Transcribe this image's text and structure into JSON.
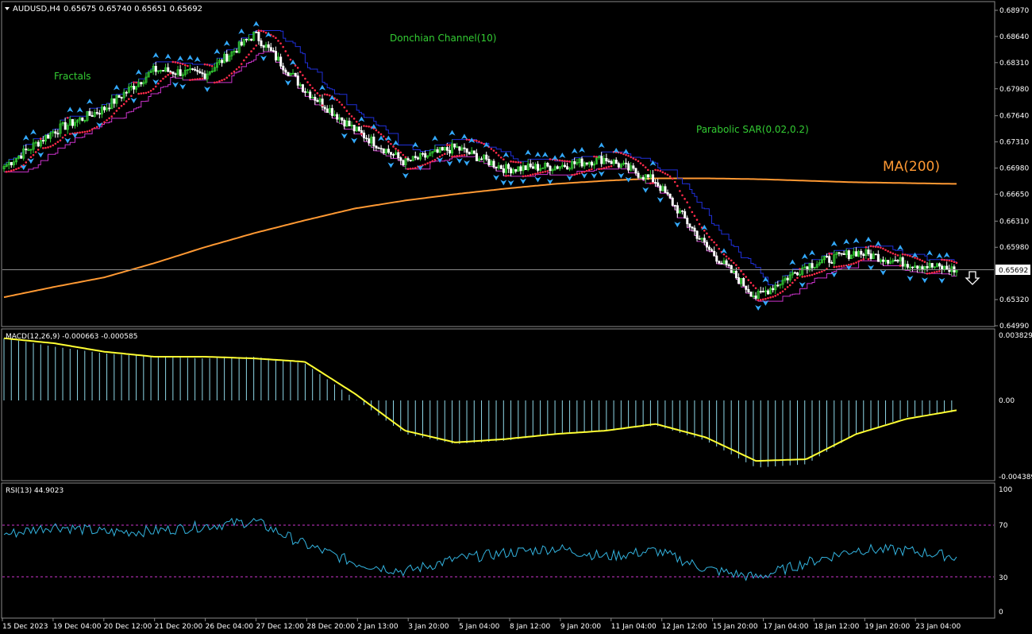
{
  "header": {
    "symbol": "AUDUSD,H4",
    "ohlc": "0.65675 0.65740 0.65651 0.65692"
  },
  "annotations": {
    "fractals": "Fractals",
    "donchian": "Donchian Channel(10)",
    "sar": "Parabolic SAR(0.02,0.2)",
    "ma": "MA(200)"
  },
  "price_axis": {
    "ticks": [
      "0.68970",
      "0.68640",
      "0.68310",
      "0.67980",
      "0.67640",
      "0.67310",
      "0.66980",
      "0.66650",
      "0.66310",
      "0.65980",
      "0.65320",
      "0.64990"
    ],
    "current_price_label": "0.65692"
  },
  "macd": {
    "label": "MACD(12,26,9) -0.000663 -0.000585",
    "ticks": [
      "0.003829",
      "0.00",
      "-0.004389"
    ]
  },
  "rsi": {
    "label": "RSI(13) 44.9023",
    "ticks": [
      "100",
      "70",
      "30",
      "0"
    ]
  },
  "time_axis": {
    "labels": [
      "15 Dec 2023",
      "19 Dec 04:00",
      "20 Dec 12:00",
      "21 Dec 20:00",
      "26 Dec 04:00",
      "27 Dec 12:00",
      "28 Dec 20:00",
      "2 Jan 13:00",
      "3 Jan 20:00",
      "5 Jan 04:00",
      "8 Jan 12:00",
      "9 Jan 20:00",
      "11 Jan 04:00",
      "12 Jan 12:00",
      "15 Jan 20:00",
      "17 Jan 04:00",
      "18 Jan 12:00",
      "19 Jan 20:00",
      "23 Jan 04:00"
    ]
  },
  "colors": {
    "background": "#000000",
    "bull_candle": "#33cc33",
    "bear_candle": "#ffffff",
    "donchian_upper": "#1f2fd8",
    "donchian_lower": "#cc33cc",
    "ma": "#ff9933",
    "sar": "#ff2a4a",
    "fractal": "#33aaff",
    "macd_hist": "#8fd8e8",
    "macd_signal": "#ffff33",
    "rsi_line": "#33b4e0",
    "rsi_level": "#cc33cc",
    "annotation": "#33cc33",
    "ma_label": "#ff9933"
  },
  "chart_data": {
    "type": "line",
    "y_range_price": [
      0.6499,
      0.6897
    ],
    "sample_x_index": [
      0,
      20,
      40,
      60,
      80,
      100,
      120,
      140,
      160,
      180,
      200,
      220,
      240,
      260,
      280,
      300,
      320,
      340,
      360,
      380
    ],
    "close_approx": [
      0.67,
      0.6745,
      0.6773,
      0.6822,
      0.6816,
      0.6867,
      0.6797,
      0.6746,
      0.6705,
      0.6724,
      0.6697,
      0.67,
      0.671,
      0.6681,
      0.6599,
      0.6535,
      0.6575,
      0.6592,
      0.6578,
      0.65692
    ],
    "ma200_approx": [
      0.6535,
      0.6548,
      0.656,
      0.6578,
      0.6598,
      0.6616,
      0.6632,
      0.6647,
      0.6657,
      0.6665,
      0.6672,
      0.6678,
      0.6682,
      0.6685,
      0.6685,
      0.6684,
      0.6682,
      0.668,
      0.6679,
      0.6678
    ],
    "macd_hist_approx": [
      0.0037,
      0.0032,
      0.0028,
      0.0026,
      0.0025,
      0.0026,
      0.0022,
      0.0001,
      -0.002,
      -0.0026,
      -0.0024,
      -0.002,
      -0.0018,
      -0.0015,
      -0.0024,
      -0.004,
      -0.0038,
      -0.002,
      -0.001,
      -0.000663
    ],
    "macd_signal_approx": [
      0.0037,
      0.0034,
      0.0029,
      0.0026,
      0.0026,
      0.0025,
      0.0023,
      0.0004,
      -0.0018,
      -0.0025,
      -0.0023,
      -0.002,
      -0.0018,
      -0.0014,
      -0.0022,
      -0.0036,
      -0.0035,
      -0.002,
      -0.0011,
      -0.000585
    ],
    "rsi_approx": [
      63,
      70,
      65,
      66,
      70,
      74,
      55,
      40,
      33,
      43,
      48,
      52,
      45,
      50,
      35,
      28,
      40,
      51,
      50,
      44.9
    ]
  }
}
